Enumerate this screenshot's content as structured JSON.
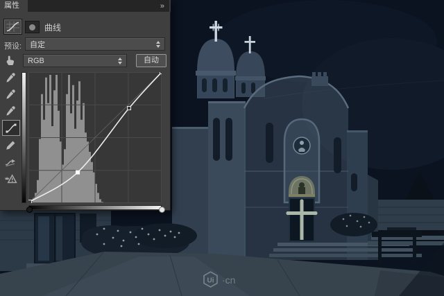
{
  "panel": {
    "tab_title": "属性",
    "panel_menu_icon": "»",
    "adjustment_title": "曲线",
    "preset_label": "预设:",
    "preset_value": "自定",
    "channel_value": "RGB",
    "auto_button_label": "自动",
    "tools": [
      {
        "name": "targeted-adjustment-tool",
        "glyph": "hand"
      },
      {
        "name": "black-point-eyedropper",
        "glyph": "eyedropper"
      },
      {
        "name": "gray-point-eyedropper",
        "glyph": "eyedropper"
      },
      {
        "name": "white-point-eyedropper",
        "glyph": "eyedropper"
      },
      {
        "name": "edit-points-tool",
        "glyph": "curve",
        "selected": true
      },
      {
        "name": "pencil-tool",
        "glyph": "pencil"
      },
      {
        "name": "smooth-curve-tool",
        "glyph": "smooth"
      },
      {
        "name": "histogram-warning",
        "glyph": "warning"
      }
    ]
  },
  "chart_data": {
    "type": "area",
    "title": "Curves adjustment: RGB channel histogram with tone curve",
    "x_range": [
      0,
      255
    ],
    "y_range": [
      0,
      255
    ],
    "grid_divisions": 4,
    "histogram_bins": [
      0,
      1,
      4,
      8,
      18,
      50,
      85,
      65,
      98,
      78,
      100,
      60,
      88,
      100,
      72,
      48,
      30,
      42,
      85,
      100,
      70,
      92,
      58,
      80,
      95,
      65,
      78,
      55,
      48,
      40,
      32,
      24,
      15,
      8,
      3,
      1,
      0,
      0,
      0,
      0,
      0,
      0,
      0,
      0,
      0,
      0,
      0,
      0,
      0,
      0,
      0,
      0,
      0,
      0,
      0,
      0,
      0,
      0,
      0,
      0,
      0,
      0,
      0,
      0
    ],
    "curve_points": [
      {
        "x": 0.01,
        "y": 0.01
      },
      {
        "x": 0.37,
        "y": 0.235
      },
      {
        "x": 0.755,
        "y": 0.725
      },
      {
        "x": 1.0,
        "y": 1.0
      }
    ],
    "selected_point_index": 1
  },
  "watermark": {
    "logo_text": "Ui",
    "suffix": "·cn"
  },
  "colors": {
    "panel_bg": "#3f3f3f",
    "tabbar_bg": "#252525",
    "field_bg": "#4c4c4c",
    "graph_bg": "#373737",
    "histogram_fill": "#909090",
    "grid_line": "#4a4a4a",
    "baseline": "#606060",
    "curve_color": "#ececec",
    "photo_sky": "#0b1220"
  }
}
